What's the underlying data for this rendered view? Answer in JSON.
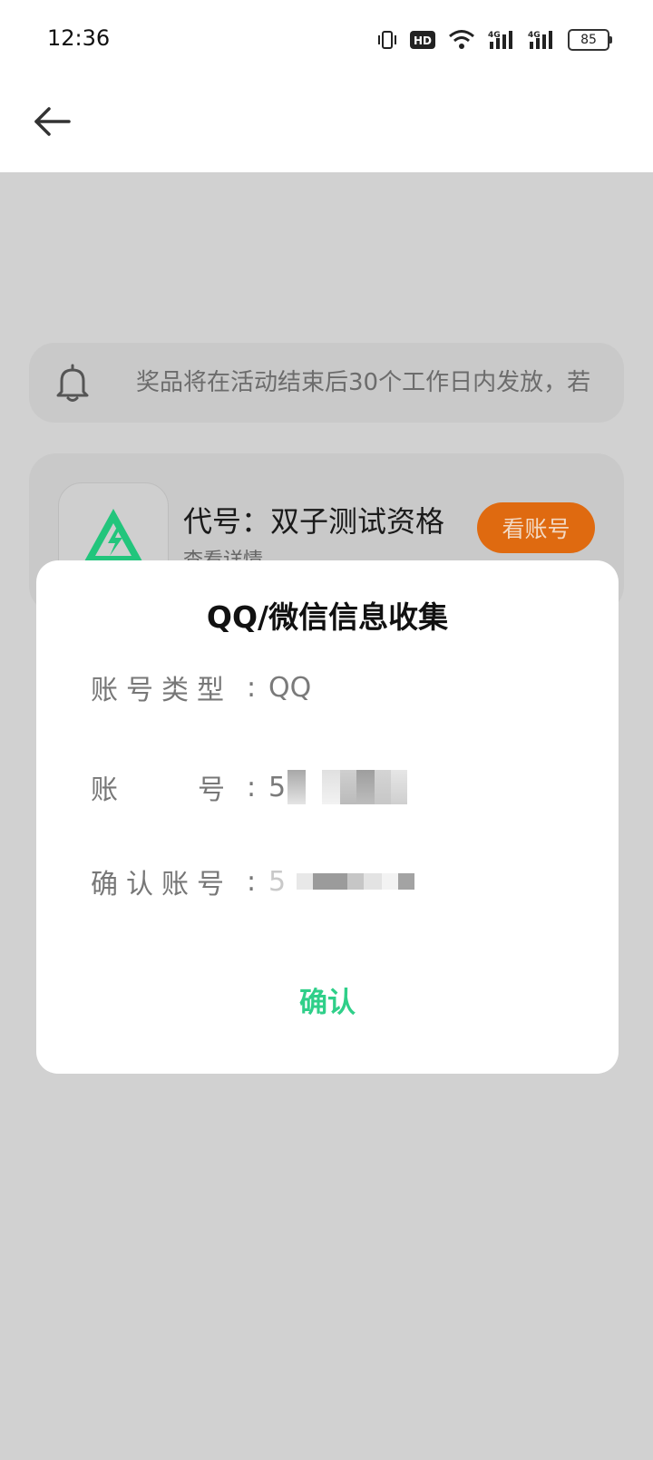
{
  "status_bar": {
    "time": "12:36",
    "battery": "85",
    "network": [
      "4G",
      "4G"
    ],
    "icons": [
      "vibrate-icon",
      "hd-icon",
      "wifi-icon",
      "signal-4g-icon",
      "signal-4g-icon",
      "battery-icon"
    ]
  },
  "nav": {
    "back_icon": "arrow-left-icon"
  },
  "notice": {
    "icon": "bell-icon",
    "text": "奖品将在活动结束后30个工作日内发放，若"
  },
  "card": {
    "title": "代号：双子测试资格",
    "subtitle": "查看详情",
    "button_label": "看账号",
    "button_color": "#df6a10"
  },
  "dialog": {
    "title": "QQ/微信信息收集",
    "fields": [
      {
        "label": "账号类型",
        "value": "QQ"
      },
      {
        "label": "账号",
        "value_visible": "5"
      },
      {
        "label": "确认账号",
        "value_visible": "5"
      }
    ],
    "confirm_label": "确认",
    "confirm_color": "#2fcf89"
  },
  "colors": {
    "overlay": "#d1d1d1",
    "card": "#c9c9c9"
  }
}
